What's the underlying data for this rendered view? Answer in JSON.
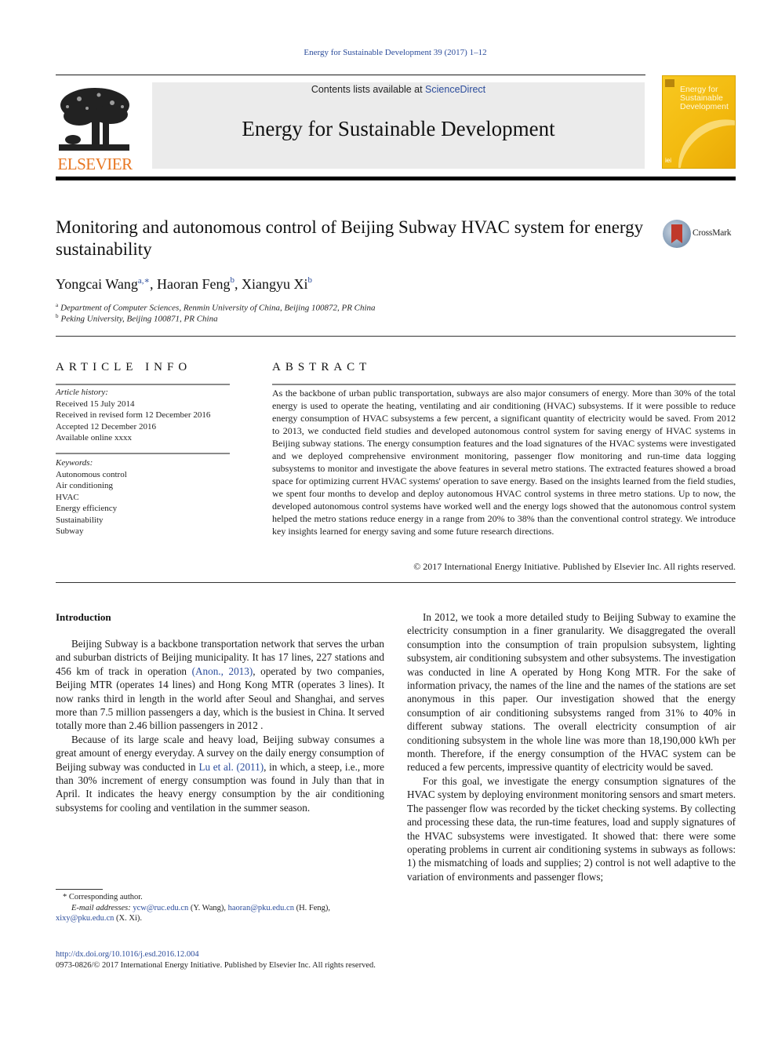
{
  "header": {
    "journal_ref": "Energy for Sustainable Development 39 (2017) 1–12",
    "contents_prefix": "Contents lists available at ",
    "contents_link": "ScienceDirect",
    "journal_title": "Energy for Sustainable Development",
    "publisher_logo_text": "ELSEVIER",
    "cover": {
      "title_line1": "Energy for",
      "title_line2": "Sustainable",
      "title_line3": "Development",
      "badge": "iei",
      "colors": {
        "background": "#f2b90e",
        "publisher_orange": "#e87722"
      }
    },
    "crossmark_label": "CrossMark"
  },
  "article": {
    "title": "Monitoring and autonomous control of Beijing Subway HVAC system for energy sustainability",
    "authors": [
      {
        "name": "Yongcai Wang",
        "sup": "a,∗"
      },
      {
        "name": "Haoran Feng",
        "sup": "b"
      },
      {
        "name": "Xiangyu Xi",
        "sup": "b"
      }
    ],
    "affiliations": [
      {
        "key": "a",
        "text": "Department of Computer Sciences, Renmin University of China, Beijing 100872, PR China"
      },
      {
        "key": "b",
        "text": "Peking University, Beijing 100871, PR China"
      }
    ]
  },
  "article_info": {
    "heading": "ARTICLE INFO",
    "history_label": "Article history:",
    "history": [
      "Received 15 July 2014",
      "Received in revised form 12 December 2016",
      "Accepted 12 December 2016",
      "Available online xxxx"
    ],
    "keywords_label": "Keywords:",
    "keywords": [
      "Autonomous control",
      "Air conditioning",
      "HVAC",
      "Energy efficiency",
      "Sustainability",
      "Subway"
    ]
  },
  "abstract": {
    "heading": "ABSTRACT",
    "text": "As the backbone of urban public transportation, subways are also major consumers of energy. More than 30% of the total energy is used to operate the heating, ventilating and air conditioning (HVAC) subsystems. If it were possible to reduce energy consumption of HVAC subsystems a few percent, a significant quantity of electricity would be saved. From 2012 to 2013, we conducted field studies and developed autonomous control system for saving energy of HVAC systems in Beijing subway stations. The energy consumption features and the load signatures of the HVAC systems were investigated and we deployed comprehensive environment monitoring, passenger flow monitoring and run-time data logging subsystems to monitor and investigate the above features in several metro stations. The extracted features showed a broad space for optimizing current HVAC systems' operation to save energy. Based on the insights learned from the field studies, we spent four months to develop and deploy autonomous HVAC control systems in three metro stations. Up to now, the developed autonomous control systems have worked well and the energy logs showed that the autonomous control system helped the metro stations reduce energy in a range from 20% to 38% than the conventional control strategy. We introduce key insights learned for energy saving and some future research directions.",
    "copyright": "© 2017 International Energy Initiative. Published by Elsevier Inc. All rights reserved."
  },
  "body": {
    "intro_heading": "Introduction",
    "left_p1_a": "Beijing Subway is a backbone transportation network that serves the urban and suburban districts of Beijing municipality. It has 17 lines, 227 stations and 456 km of track in operation ",
    "left_p1_cite": "(Anon., 2013)",
    "left_p1_b": ", operated by two companies, Beijing MTR (operates 14 lines) and Hong Kong MTR (operates 3 lines). It now ranks third in length in the world after Seoul and Shanghai, and serves more than 7.5 million passengers a day, which is the busiest in China. It served totally more than 2.46 billion passengers in 2012 .",
    "left_p2_a": "Because of its large scale and heavy load, Beijing subway consumes a great amount of energy everyday. A survey on the daily energy consumption of Beijing subway was conducted in ",
    "left_p2_cite": "Lu et al. (2011)",
    "left_p2_b": ", in which, a steep, i.e., more than 30% increment of energy consumption was found in July than that in April. It indicates the heavy energy consumption by the air conditioning subsystems for cooling and ventilation in the summer season.",
    "right_p1": "In 2012, we took a more detailed study to Beijing Subway to examine the electricity consumption in a finer granularity. We disaggregated the overall consumption into the consumption of train propulsion subsystem, lighting subsystem, air conditioning subsystem and other subsystems. The investigation was conducted in line A operated by Hong Kong MTR. For the sake of information privacy, the names of the line and the names of the stations are set anonymous in this paper. Our investigation showed that the energy consumption of air conditioning subsystems ranged from 31% to 40% in different subway stations. The overall electricity consumption of air conditioning subsystem in the whole line was more than 18,190,000  kWh per month. Therefore, if the energy consumption of the HVAC system can be reduced a few percents, impressive quantity of electricity would be saved.",
    "right_p2": "For this goal, we investigate the energy consumption signatures of the HVAC system by deploying environment monitoring sensors and smart meters. The passenger flow was recorded by the ticket checking systems. By collecting and processing these data, the run-time features, load and supply signatures of the HVAC subsystems were investigated. It showed that: there were some operating problems in current air conditioning systems in subways as follows: 1) the mismatching of loads and supplies; 2) control is not well adaptive to the variation of environments and passenger flows;"
  },
  "footnote": {
    "marker": "*",
    "corresponding": "Corresponding author.",
    "email_label": "E-mail addresses:",
    "emails": [
      {
        "address": "ycw@ruc.edu.cn",
        "owner": " (Y. Wang), "
      },
      {
        "address": "haoran@pku.edu.cn",
        "owner": " (H. Feng),"
      },
      {
        "address": "xixy@pku.edu.cn",
        "owner": " (X. Xi)."
      }
    ]
  },
  "footer": {
    "doi": "http://dx.doi.org/10.1016/j.esd.2016.12.004",
    "issn_line": "0973-0826/© 2017  International Energy Initiative. Published by Elsevier Inc. All rights reserved."
  }
}
